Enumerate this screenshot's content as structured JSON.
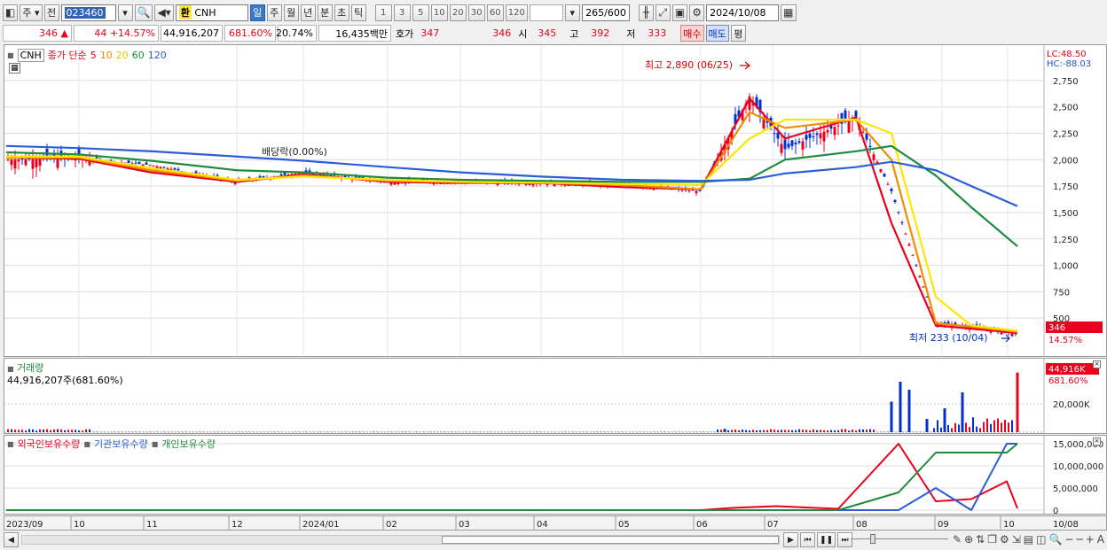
{
  "toolbar": {
    "period_tab": "주",
    "prev_label": "전",
    "stock_code": "023460",
    "exchange_badge": "환",
    "stock_name": "CNH",
    "period_buttons": [
      "일",
      "주",
      "월",
      "년",
      "분",
      "초",
      "틱"
    ],
    "interval_buttons": [
      "1",
      "3",
      "5",
      "10",
      "20",
      "30",
      "60",
      "120"
    ],
    "count": "265",
    "count_total": "/600",
    "date": "2024/10/08"
  },
  "quote": {
    "price": "346",
    "change_arrow": "▲",
    "change": "44",
    "change_pct": "+14.57%",
    "volume": "44,916,207",
    "volume_ratio": "681.60%",
    "turnover": "20.74%",
    "amount": "16,435백만",
    "ask_label": "호가",
    "ask": "347",
    "bid": "346",
    "open_label": "시",
    "open": "345",
    "high_label": "고",
    "high": "392",
    "low_label": "저",
    "low": "333",
    "buy_button": "매수",
    "sell_button": "매도",
    "eval_button": "평"
  },
  "price_panel": {
    "name_tag": "CNH",
    "ma_label": "종가 단순",
    "ma_periods": [
      "5",
      "10",
      "20",
      "60",
      "120"
    ],
    "ma_colors": [
      "#e8001c",
      "#f08c00",
      "#ffe600",
      "#1e8c3c",
      "#2a5ed8"
    ],
    "lc_label": "LC:48.50",
    "hc_label": "HC:-88.03",
    "high_annotation": "최고 2,890 (06/25)",
    "low_annotation": "최저 233 (10/04)",
    "dividend_label": "배당락(0.00%)",
    "current_price_tag": "346",
    "current_pct_tag": "14.57%",
    "y_ticks": [
      "2,750",
      "2,500",
      "2,250",
      "2,000",
      "1,750",
      "1,500",
      "1,250",
      "1,000",
      "750",
      "500"
    ]
  },
  "volume_panel": {
    "title": "거래량",
    "subtitle": "44,916,207주(681.60%)",
    "tag_value": "44,916K",
    "tag_pct": "681.60%",
    "y_tick": "20,000K"
  },
  "holdings_panel": {
    "legend": [
      "외국인보유수량",
      "기관보유수량",
      "개인보유수량"
    ],
    "legend_colors": [
      "#e8001c",
      "#2a5ed8",
      "#1e8c3c"
    ],
    "y_ticks": [
      "15,000,000",
      "10,000,000",
      "5,000,000",
      "0"
    ]
  },
  "x_axis": [
    "2023/09",
    "10",
    "11",
    "12",
    "2024/01",
    "02",
    "03",
    "04",
    "05",
    "06",
    "07",
    "08",
    "09",
    "10",
    "10/08"
  ],
  "chart_data": [
    {
      "type": "candlestick",
      "title": "",
      "ylim": [
        250,
        2900
      ],
      "weekly_close_approx": [
        {
          "x": "2023/09",
          "y": 2000
        },
        {
          "x": "10",
          "y": 2010
        },
        {
          "x": "11",
          "y": 1950
        },
        {
          "x": "12",
          "y": 1790
        },
        {
          "x": "2024/01",
          "y": 1880
        },
        {
          "x": "02",
          "y": 1790
        },
        {
          "x": "03",
          "y": 1790
        },
        {
          "x": "04",
          "y": 1780
        },
        {
          "x": "05",
          "y": 1760
        },
        {
          "x": "06",
          "y": 1700
        },
        {
          "x": "06/25",
          "y": 2600
        },
        {
          "x": "07",
          "y": 2100
        },
        {
          "x": "07 end",
          "y": 2400
        },
        {
          "x": "08 mid",
          "y": 1700
        },
        {
          "x": "08 end",
          "y": 450
        },
        {
          "x": "09",
          "y": 420
        },
        {
          "x": "10",
          "y": 346
        }
      ],
      "series": [
        {
          "name": "5",
          "values": [
            2020,
            2010,
            1880,
            1790,
            1860,
            1790,
            1780,
            1780,
            1740,
            1720,
            2580,
            2200,
            2400,
            1400,
            430,
            400,
            360
          ]
        },
        {
          "name": "10",
          "values": [
            2020,
            2020,
            1900,
            1800,
            1850,
            1800,
            1790,
            1780,
            1760,
            1720,
            2450,
            2300,
            2380,
            2000,
            450,
            420,
            370
          ]
        },
        {
          "name": "20",
          "values": [
            2030,
            2030,
            1920,
            1810,
            1840,
            1810,
            1790,
            1785,
            1770,
            1760,
            2200,
            2380,
            2380,
            2250,
            700,
            430,
            380
          ]
        },
        {
          "name": "60",
          "values": [
            2070,
            2050,
            1990,
            1900,
            1880,
            1830,
            1810,
            1800,
            1790,
            1790,
            1820,
            2000,
            2080,
            2130,
            1850,
            1550,
            1180
          ]
        },
        {
          "name": "120",
          "values": [
            2130,
            2110,
            2080,
            2030,
            1990,
            1930,
            1880,
            1840,
            1810,
            1800,
            1810,
            1870,
            1930,
            1980,
            1900,
            1750,
            1560
          ]
        }
      ],
      "annotations": [
        "최고 2,890 (06/25)",
        "최저 233 (10/04)",
        "배당락(0.00%)"
      ]
    },
    {
      "type": "bar",
      "title": "거래량",
      "ylim": [
        0,
        50000000
      ],
      "latest_value": 44916207,
      "values_approx": [
        {
          "x": "06/25",
          "y": 2500000
        },
        {
          "x": "08/12",
          "y": 23000000
        },
        {
          "x": "08/19",
          "y": 38000000
        },
        {
          "x": "08/26",
          "y": 32000000
        },
        {
          "x": "09/02",
          "y": 10000000
        },
        {
          "x": "09/09",
          "y": 18000000
        },
        {
          "x": "09/23",
          "y": 30000000
        },
        {
          "x": "10/07",
          "y": 44916207
        }
      ]
    },
    {
      "type": "line",
      "title": "",
      "ylim": [
        0,
        16000000
      ],
      "series": [
        {
          "name": "외국인보유수량",
          "values_approx": [
            0,
            0,
            0,
            0,
            0,
            0,
            0,
            0,
            0,
            0,
            500000,
            900000,
            300000,
            15000000,
            2000000,
            2500000,
            6500000,
            400000
          ]
        },
        {
          "name": "기관보유수량",
          "values_approx": [
            0,
            0,
            0,
            0,
            0,
            0,
            0,
            0,
            0,
            0,
            0,
            0,
            0,
            0,
            5000000,
            0,
            15000000,
            15000000
          ]
        },
        {
          "name": "개인보유수량",
          "values_approx": [
            0,
            0,
            0,
            0,
            0,
            0,
            0,
            0,
            0,
            0,
            0,
            0,
            0,
            4000000,
            13000000,
            13000000,
            13000000,
            15000000
          ]
        }
      ]
    }
  ]
}
